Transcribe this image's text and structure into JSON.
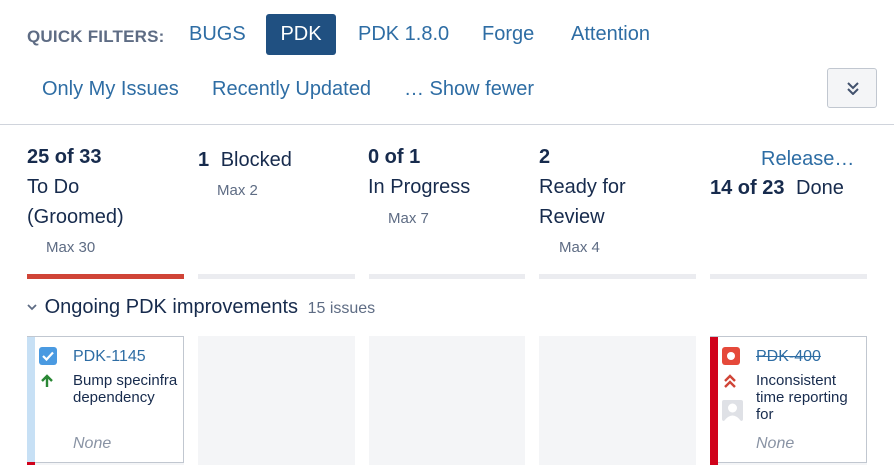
{
  "quick_filters": {
    "label": "QUICK FILTERS:",
    "items": [
      "BUGS",
      "PDK",
      "PDK 1.8.0",
      "Forge",
      "Attention"
    ],
    "active": "PDK",
    "row2": [
      "Only My Issues",
      "Recently Updated",
      "… Show fewer"
    ]
  },
  "columns": [
    {
      "count": "25 of 33",
      "name_line1": "To Do",
      "name_line2": "(Groomed)",
      "max": "Max 30",
      "over_limit": true
    },
    {
      "count": "1",
      "name_line1": "Blocked",
      "max": "Max 2",
      "over_limit": false
    },
    {
      "count": "0 of 1",
      "name_line1": "In Progress",
      "max": "Max 7",
      "over_limit": false
    },
    {
      "count": "2",
      "name_line1": "Ready for",
      "name_line2": "Review",
      "max": "Max 4",
      "over_limit": false
    },
    {
      "count": "14 of 23",
      "name_line1": "Done",
      "release_link": "Release…",
      "over_limit": false
    }
  ],
  "swimlane": {
    "title": "Ongoing PDK improvements",
    "issues": "15 issues"
  },
  "cards": [
    {
      "key": "PDK-1145",
      "summary": "Bump specinfra dependency",
      "footer": "None",
      "type_icon": "task-icon",
      "priority_icon": "priority-major-icon",
      "resolved": false,
      "color": "#c7e0f5"
    },
    {
      "key": "PDK-400",
      "summary": "Inconsistent time reporting for",
      "footer": "None",
      "type_icon": "bug-icon",
      "priority_icon": "priority-critical-icon",
      "resolved": true,
      "color": "#d0021b"
    }
  ],
  "colors": {
    "accent": "#205081",
    "link": "#2e6da4",
    "over_limit": "#d04437"
  }
}
